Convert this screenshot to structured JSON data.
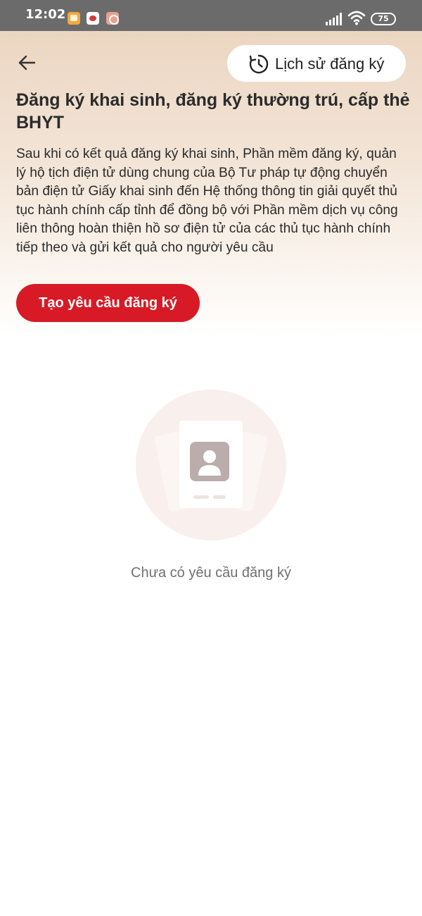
{
  "status_bar": {
    "time": "12:02",
    "battery": "75",
    "icons": [
      "notification-app-icon",
      "notification-app-icon",
      "notification-app-icon",
      "signal-icon",
      "wifi-icon",
      "battery-icon"
    ]
  },
  "header": {
    "back_icon": "arrow-left-icon",
    "history_icon": "clock-history-icon",
    "history_label": "Lịch sử đăng ký"
  },
  "main": {
    "title": "Đăng ký khai sinh, đăng ký thường trú, cấp thẻ BHYT",
    "description": "Sau khi có kết quả đăng ký khai sinh, Phần mềm đăng ký, quản lý hộ tịch điện tử dùng chung của Bộ Tư pháp tự động chuyển bản điện tử Giấy khai sinh đến Hệ thống thông tin giải quyết thủ tục hành chính cấp tỉnh để đồng bộ với Phần mềm dịch vụ công liên thông hoàn thiện hồ sơ điện tử của các thủ tục hành chính tiếp theo và gửi kết quả cho người yêu cầu",
    "create_button": "Tạo yêu cầu đăng ký"
  },
  "empty_state": {
    "icon": "profile-card-icon",
    "text": "Chưa có yêu cầu đăng ký"
  },
  "colors": {
    "accent": "#d71a25",
    "hero_top": "#ecd6c2",
    "status_bar": "#6b6b6b",
    "empty_text": "#707070"
  }
}
